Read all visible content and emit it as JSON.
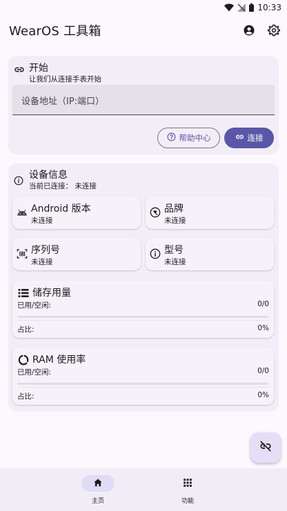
{
  "status_bar": {
    "time": "10:33",
    "icons": [
      "wifi-icon",
      "signal-off-icon",
      "battery-icon"
    ]
  },
  "app_bar": {
    "title": "WearOS 工具箱",
    "actions": [
      "account-icon",
      "settings-icon"
    ]
  },
  "connect_card": {
    "title": "开始",
    "subtitle": "让我们从连接手表开始",
    "address_placeholder": "设备地址（IP:端口）",
    "help_label": "帮助中心",
    "connect_label": "连接"
  },
  "device_card": {
    "title": "设备信息",
    "subtitle": "当前已连接：  未连接",
    "tiles": [
      {
        "label": "Android 版本",
        "value": "未连接",
        "icon": "android-icon"
      },
      {
        "label": "品牌",
        "value": "未连接",
        "icon": "brand-icon"
      },
      {
        "label": "序列号",
        "value": "未连接",
        "icon": "barcode-icon"
      },
      {
        "label": "型号",
        "value": "未连接",
        "icon": "info-icon"
      }
    ],
    "storage": {
      "title": "储存用量",
      "used_label": "已用/空闲:",
      "used_value": "0/0",
      "ratio_label": "占比:",
      "ratio_value": "0%",
      "ratio": 0
    },
    "ram": {
      "title": "RAM 使用率",
      "used_label": "已用/空闲:",
      "used_value": "0/0",
      "ratio_label": "占比:",
      "ratio_value": "0%",
      "ratio": 0
    }
  },
  "fab": {
    "icon": "link-off-icon"
  },
  "bottom_nav": {
    "items": [
      {
        "label": "主页",
        "icon": "home-icon",
        "active": true
      },
      {
        "label": "功能",
        "icon": "apps-grid-icon",
        "active": false
      }
    ]
  },
  "colors": {
    "background": "#fdf7fe",
    "card": "#f3edf7",
    "accent": "#5a57a8",
    "nav_active": "#e0dcf5"
  }
}
